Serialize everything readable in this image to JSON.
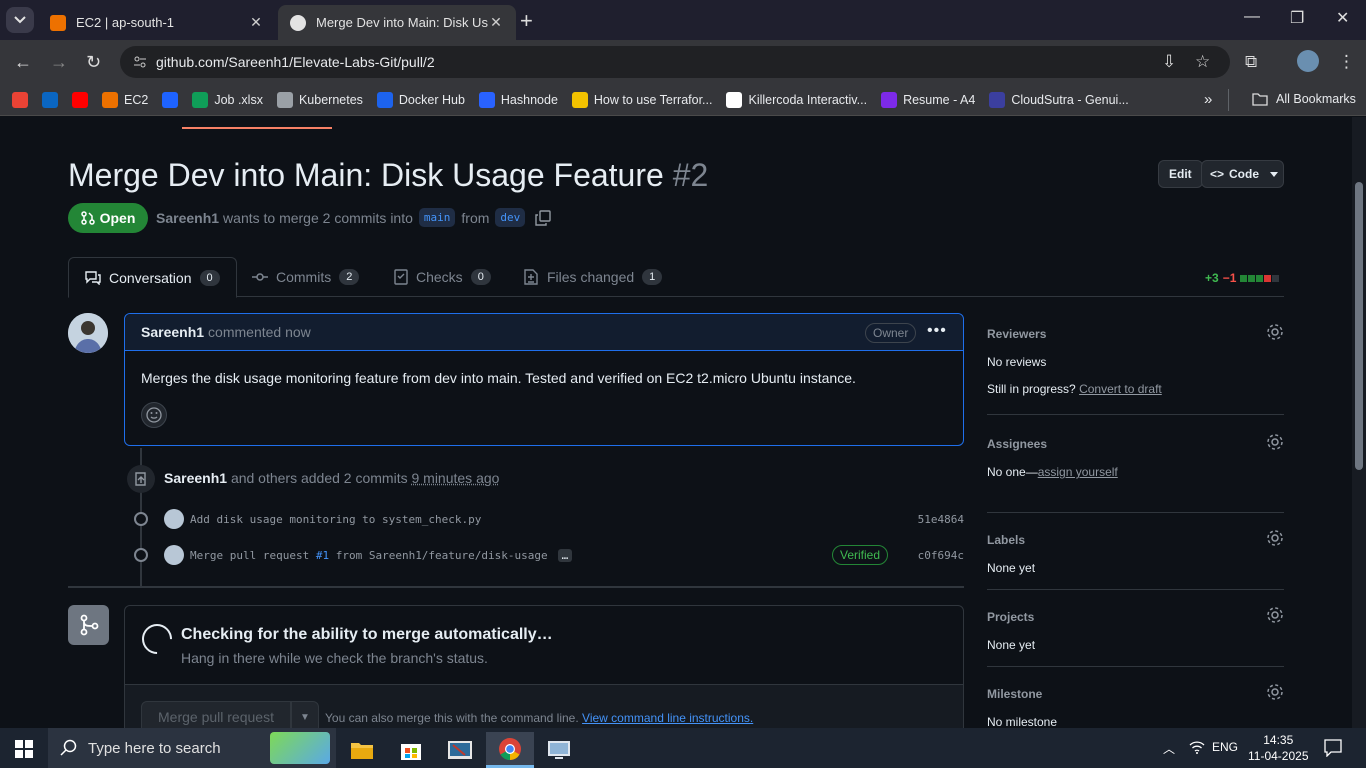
{
  "browser": {
    "tabs": [
      {
        "title": "EC2 | ap-south-1",
        "active": false,
        "favicon": "aws-ec2-icon"
      },
      {
        "title": "Merge Dev into Main: Disk Usag",
        "active": true,
        "favicon": "github-icon"
      }
    ],
    "url": "github.com/Sareenh1/Elevate-Labs-Git/pull/2",
    "bookmarks": [
      {
        "label": "",
        "icon": "gmail-icon",
        "color": "#ea4335"
      },
      {
        "label": "",
        "icon": "linkedin-icon",
        "color": "#0a66c2"
      },
      {
        "label": "",
        "icon": "youtube-icon",
        "color": "#ff0000"
      },
      {
        "label": "EC2",
        "icon": "aws-icon",
        "color": "#ed7100"
      },
      {
        "label": "",
        "icon": "kodekloud-icon",
        "color": "#1e63ff"
      },
      {
        "label": "Job .xlsx",
        "icon": "sheets-icon",
        "color": "#0f9d58"
      },
      {
        "label": "Kubernetes",
        "icon": "globe-icon",
        "color": "#9aa0a6"
      },
      {
        "label": "Docker Hub",
        "icon": "docker-icon",
        "color": "#1d63ed"
      },
      {
        "label": "Hashnode",
        "icon": "hashnode-icon",
        "color": "#2962ff"
      },
      {
        "label": "How to use Terrafor...",
        "icon": "arrow-icon",
        "color": "#f2c200"
      },
      {
        "label": "Killercoda Interactiv...",
        "icon": "killercoda-icon",
        "color": "#ffffff"
      },
      {
        "label": "Resume - A4",
        "icon": "canva-icon",
        "color": "#7d2ae8"
      },
      {
        "label": "CloudSutra - Genui...",
        "icon": "cloudsutra-icon",
        "color": "#3b3f9f"
      }
    ],
    "all_bookmarks": "All Bookmarks",
    "more_bookmarks": "»"
  },
  "pr": {
    "title": "Merge Dev into Main: Disk Usage Feature",
    "number": "#2",
    "edit_label": "Edit",
    "code_label": "Code",
    "state": "Open",
    "author": "Sareenh1",
    "meta_text": "wants to merge 2 commits into",
    "base_branch": "main",
    "from_text": "from",
    "head_branch": "dev"
  },
  "tabs": [
    {
      "label": "Conversation",
      "count": "0"
    },
    {
      "label": "Commits",
      "count": "2"
    },
    {
      "label": "Checks",
      "count": "0"
    },
    {
      "label": "Files changed",
      "count": "1"
    }
  ],
  "diffstat": {
    "additions": "+3",
    "deletions": "−1"
  },
  "comment": {
    "author": "Sareenh1",
    "action": "commented now",
    "role": "Owner",
    "body": "Merges the disk usage monitoring feature from dev into main. Tested and verified on EC2 t2.micro Ubuntu instance."
  },
  "timeline": {
    "author": "Sareenh1",
    "text": "and others added 2 commits",
    "time": "9 minutes ago",
    "commits": [
      {
        "message": "Add disk usage monitoring to system_check.py",
        "sha": "51e4864",
        "verified": false
      },
      {
        "message_prefix": "Merge pull request",
        "pr_ref": "#1",
        "message_suffix": "from Sareenh1/feature/disk-usage",
        "sha": "c0f694c",
        "verified": true,
        "verified_label": "Verified",
        "ellipsis": "…"
      }
    ]
  },
  "merge": {
    "title": "Checking for the ability to merge automatically…",
    "subtitle": "Hang in there while we check the branch's status.",
    "button": "Merge pull request",
    "hint": "You can also merge this with the command line.",
    "hint_link": "View command line instructions."
  },
  "sidebar": {
    "reviewers": {
      "title": "Reviewers",
      "value": "No reviews",
      "progress_q": "Still in progress?",
      "progress_link": "Convert to draft"
    },
    "assignees": {
      "title": "Assignees",
      "value": "No one—",
      "link": "assign yourself"
    },
    "labels": {
      "title": "Labels",
      "value": "None yet"
    },
    "projects": {
      "title": "Projects",
      "value": "None yet"
    },
    "milestone": {
      "title": "Milestone",
      "value": "No milestone"
    }
  },
  "taskbar": {
    "search_placeholder": "Type here to search",
    "language": "ENG",
    "time": "14:35",
    "date": "11-04-2025"
  }
}
